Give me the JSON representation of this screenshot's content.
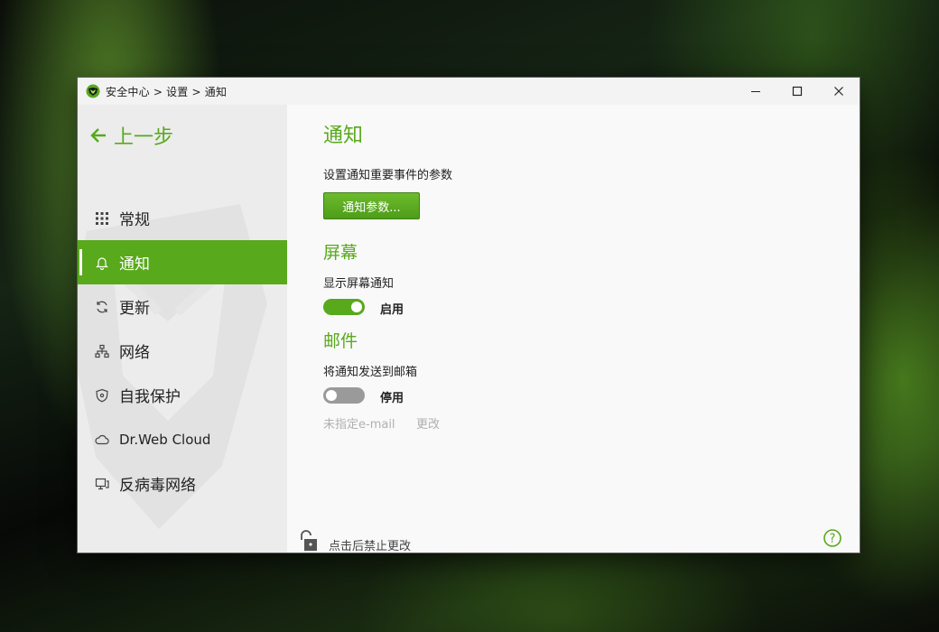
{
  "window": {
    "breadcrumb": "安全中心 > 设置 > 通知",
    "controls": {
      "minimize": "—",
      "maximize": "☐",
      "close": "✕"
    }
  },
  "sidebar": {
    "back_label": "上一步",
    "items": [
      {
        "label": "常规",
        "icon": "grid-icon"
      },
      {
        "label": "通知",
        "icon": "bell-icon",
        "active": true
      },
      {
        "label": "更新",
        "icon": "refresh-icon"
      },
      {
        "label": "网络",
        "icon": "network-icon"
      },
      {
        "label": "自我保护",
        "icon": "shield-icon"
      },
      {
        "label": "Dr.Web Cloud",
        "icon": "cloud-icon"
      },
      {
        "label": "反病毒网络",
        "icon": "monitor-icon"
      }
    ]
  },
  "main": {
    "title": "通知",
    "notify_desc": "设置通知重要事件的参数",
    "notify_button": "通知参数...",
    "screen": {
      "title": "屏幕",
      "desc": "显示屏幕通知",
      "toggle_on": true,
      "toggle_label": "启用"
    },
    "mail": {
      "title": "邮件",
      "desc": "将通知发送到邮箱",
      "toggle_on": false,
      "toggle_label": "停用",
      "email_status": "未指定e-mail",
      "change_label": "更改"
    }
  },
  "footer": {
    "lock_label": "点击后禁止更改",
    "help_icon": "help-icon"
  },
  "colors": {
    "accent": "#58a91c",
    "sidebar_bg": "#ececec",
    "main_bg": "#f9f9f9",
    "toggle_off": "#9a9a9a"
  }
}
